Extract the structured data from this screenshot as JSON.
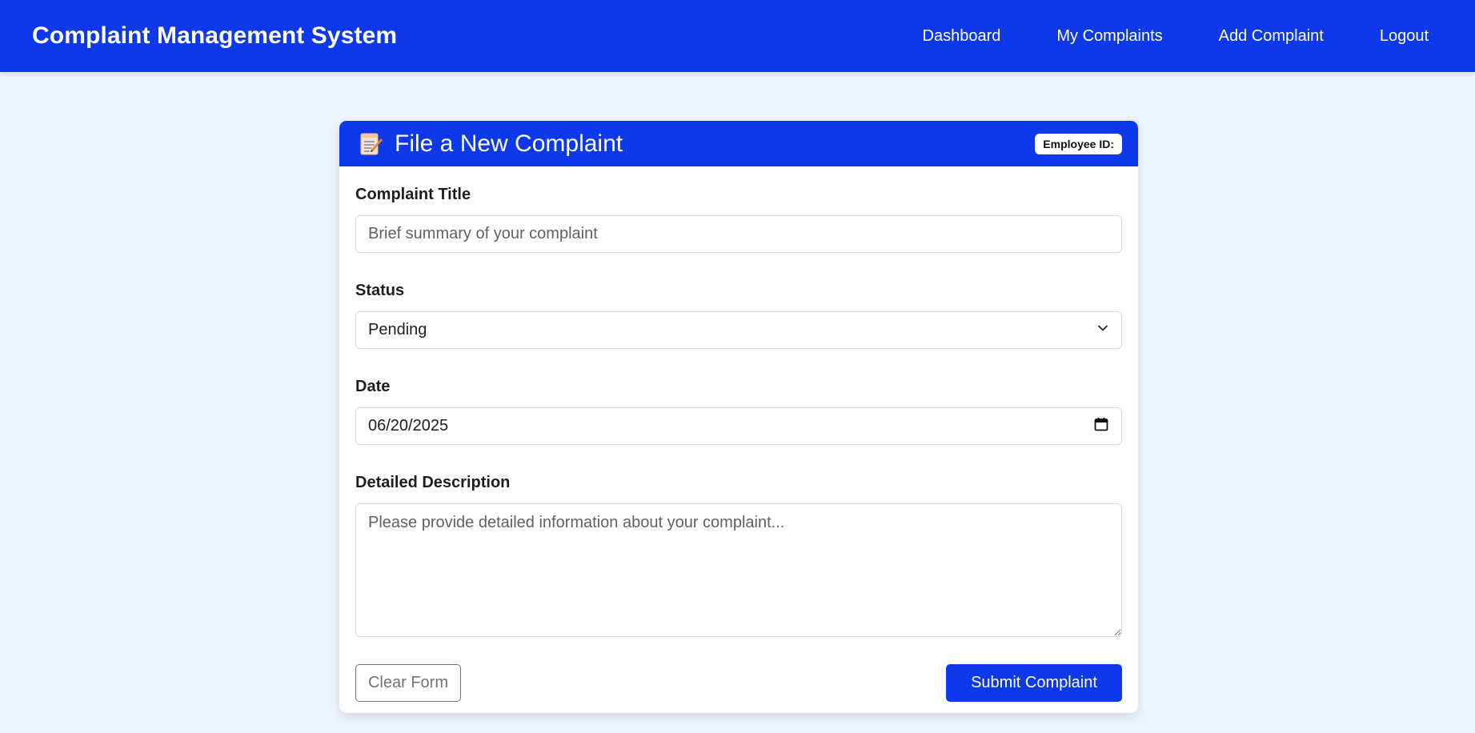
{
  "app": {
    "title": "Complaint Management System"
  },
  "nav": {
    "items": [
      {
        "label": "Dashboard"
      },
      {
        "label": "My Complaints"
      },
      {
        "label": "Add Complaint"
      },
      {
        "label": "Logout"
      }
    ]
  },
  "form": {
    "icon": "memo-icon",
    "title": "File a New Complaint",
    "employee_id_label": "Employee ID:",
    "complaint_title": {
      "label": "Complaint Title",
      "value": "",
      "placeholder": "Brief summary of your complaint"
    },
    "status": {
      "label": "Status",
      "selected": "Pending"
    },
    "date": {
      "label": "Date",
      "value": "06/20/2025"
    },
    "description": {
      "label": "Detailed Description",
      "value": "",
      "placeholder": "Please provide detailed information about your complaint..."
    },
    "clear_label": "Clear Form",
    "submit_label": "Submit Complaint"
  },
  "colors": {
    "primary": "#0d39ea",
    "page_bg": "#eef5ff",
    "secondary": "#6c757d"
  }
}
